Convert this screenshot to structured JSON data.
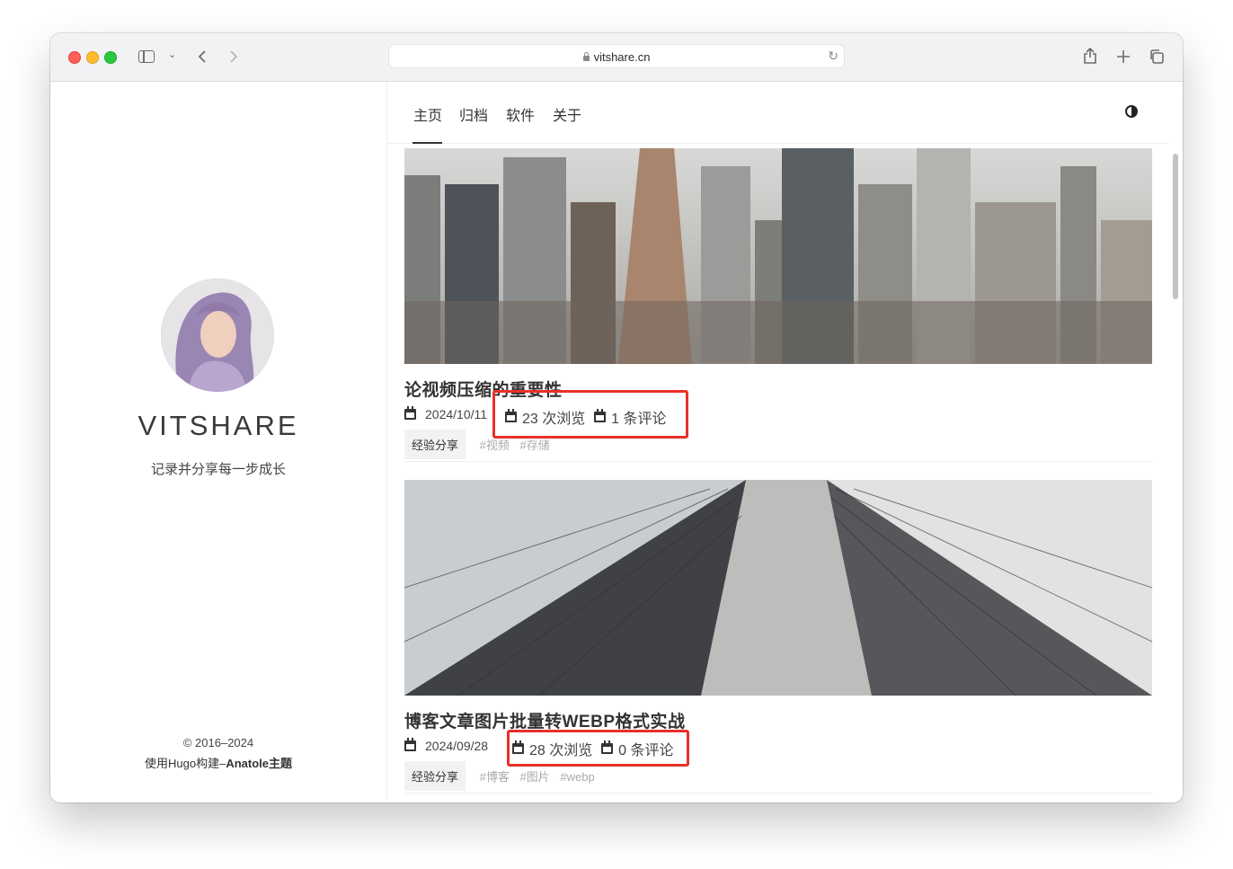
{
  "browser": {
    "url": "vitshare.cn"
  },
  "sidebar": {
    "site_name": "VITSHARE",
    "tagline": "记录并分享每一步成长",
    "copyright": "© 2016–2024",
    "built_with_prefix": "使用Hugo构建–",
    "built_with_theme": "Anatole主题"
  },
  "nav": {
    "items": [
      "主页",
      "归档",
      "软件",
      "关于"
    ]
  },
  "posts": [
    {
      "title": "论视频压缩的重要性",
      "date": "2024/10/11",
      "views": "23 次浏览",
      "comments": "1 条评论",
      "category": "经验分享",
      "tags": [
        "#视频",
        "#存储"
      ]
    },
    {
      "title": "博客文章图片批量转WEBP格式实战",
      "date": "2024/09/28",
      "views": "28 次浏览",
      "comments": "0 条评论",
      "category": "经验分享",
      "tags": [
        "#博客",
        "#图片",
        "#webp"
      ]
    }
  ],
  "colors": {
    "highlight": "#e8302a",
    "traffic_red": "#fe5f57",
    "traffic_yellow": "#febc2e",
    "traffic_green": "#28c840"
  }
}
